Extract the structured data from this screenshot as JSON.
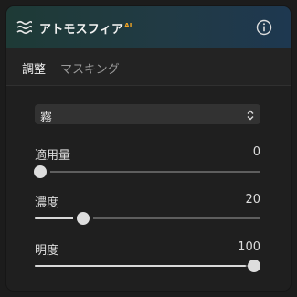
{
  "header": {
    "title": "アトモスフィア",
    "title_superscript": "AI",
    "icon": "fog-icon",
    "info_icon": "info-icon"
  },
  "tabs": [
    {
      "label": "調整",
      "active": true
    },
    {
      "label": "マスキング",
      "active": false
    }
  ],
  "preset_select": {
    "value": "霧",
    "icon": "chevron-updown-icon"
  },
  "sliders": [
    {
      "label": "適用量",
      "value": "0",
      "level": 0
    },
    {
      "label": "濃度",
      "value": "20",
      "level": 0.2
    },
    {
      "label": "明度",
      "value": "100",
      "level": 1.0
    }
  ],
  "colors": {
    "accent_superscript": "#f5a623",
    "header_gradient_start": "#1e3a36",
    "header_gradient_end": "#1e3850"
  }
}
